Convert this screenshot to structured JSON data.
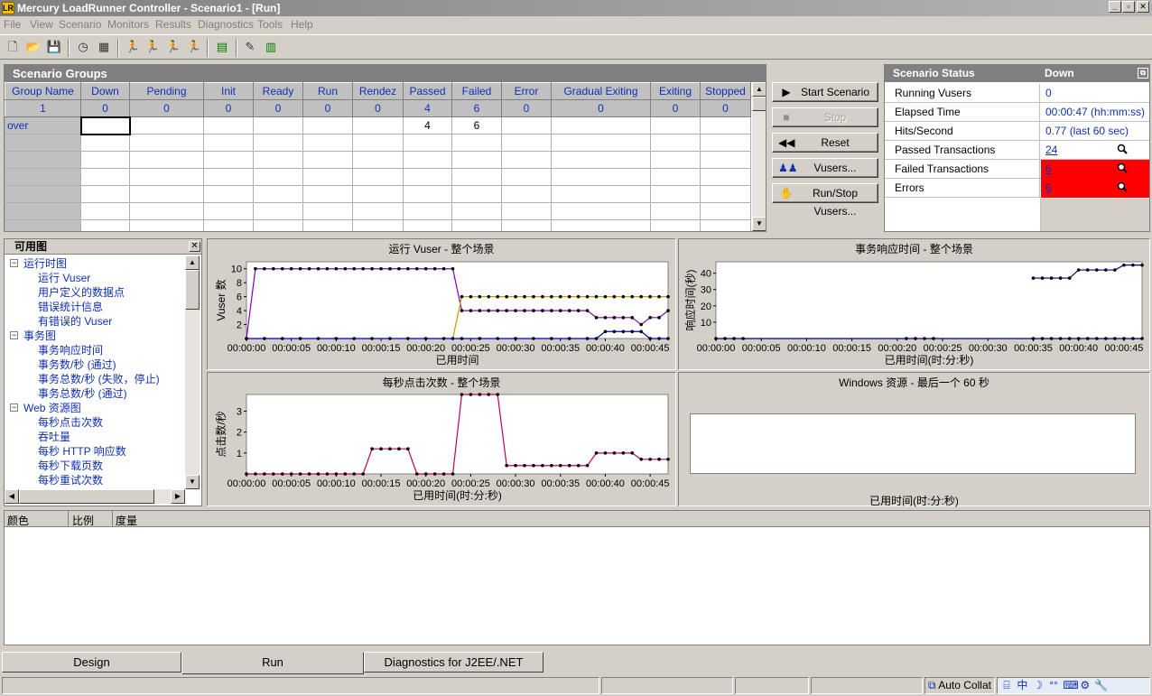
{
  "window": {
    "title": "Mercury LoadRunner Controller - Scenario1 - [Run]",
    "app_icon": "LR"
  },
  "menu": [
    "File",
    "View",
    "Scenario",
    "Monitors",
    "Results",
    "Diagnostics",
    "Tools",
    "Help"
  ],
  "toolbar_icons": [
    "new-icon",
    "open-icon",
    "save-icon",
    "clock-icon",
    "rendezvous-icon",
    "run-vuser-icon",
    "gradual-icon",
    "stop-vuser-icon",
    "reset-vuser-icon",
    "analysis-icon",
    "results-icon",
    "monitor-icon"
  ],
  "groups": {
    "title": "Scenario Groups",
    "columns": [
      "Group Name",
      "Down",
      "Pending",
      "Init",
      "Ready",
      "Run",
      "Rendez",
      "Passed",
      "Failed",
      "Error",
      "Gradual Exiting",
      "Exiting",
      "Stopped"
    ],
    "totals": [
      "1",
      "0",
      "0",
      "0",
      "0",
      "0",
      "0",
      "4",
      "6",
      "0",
      "0",
      "0",
      "0"
    ],
    "rows": [
      [
        "over",
        "",
        "",
        "",
        "",
        "",
        "",
        "4",
        "6",
        "",
        "",
        "",
        ""
      ]
    ]
  },
  "actions": {
    "start": "Start Scenario",
    "stop": "Stop",
    "reset": "Reset",
    "vusers": "Vusers...",
    "runstop": "Run/Stop Vusers..."
  },
  "status": {
    "title": "Scenario Status",
    "state": "Down",
    "rows": [
      {
        "key": "Running Vusers",
        "value": "0"
      },
      {
        "key": "Elapsed Time",
        "value": "00:00:47 (hh:mm:ss)"
      },
      {
        "key": "Hits/Second",
        "value": "0.77 (last 60 sec)"
      },
      {
        "key": "Passed Transactions",
        "value": "24"
      },
      {
        "key": "Failed Transactions",
        "value": "6"
      },
      {
        "key": "Errors",
        "value": "6"
      }
    ],
    "error_color": "#ff0000"
  },
  "tree": {
    "title": "可用图",
    "items": [
      {
        "label": "运行时图",
        "level": 0,
        "box": "−"
      },
      {
        "label": "运行 Vuser",
        "level": 1
      },
      {
        "label": "用户定义的数据点",
        "level": 1
      },
      {
        "label": "错误统计信息",
        "level": 1
      },
      {
        "label": "有错误的 Vuser",
        "level": 1
      },
      {
        "label": "事务图",
        "level": 0,
        "box": "−"
      },
      {
        "label": "事务响应时间",
        "level": 1
      },
      {
        "label": "事务数/秒 (通过)",
        "level": 1
      },
      {
        "label": "事务总数/秒 (失败，停止)",
        "level": 1
      },
      {
        "label": "事务总数/秒 (通过)",
        "level": 1
      },
      {
        "label": "Web 资源图",
        "level": 0,
        "box": "−"
      },
      {
        "label": "每秒点击次数",
        "level": 1
      },
      {
        "label": "吞吐量",
        "level": 1
      },
      {
        "label": "每秒 HTTP 响应数",
        "level": 1
      },
      {
        "label": "每秒下载页数",
        "level": 1
      },
      {
        "label": "每秒重试次数",
        "level": 1
      }
    ]
  },
  "graphs": {
    "vuser": {
      "title": "运行 Vuser - 整个场景",
      "ylabel": "Vuser 数",
      "xlabel": "已用时间"
    },
    "trt": {
      "title": "事务响应时间 - 整个场景",
      "ylabel": "响应时间(秒)",
      "xlabel": "已用时间(时:分:秒)"
    },
    "hits": {
      "title": "每秒点击次数 - 整个场景",
      "ylabel": "点击数/秒",
      "xlabel": "已用时间(时:分:秒)"
    },
    "win": {
      "title": "Windows 资源 - 最后一个 60 秒",
      "xlabel": "已用时间(时:分:秒)"
    }
  },
  "chart_data": [
    {
      "type": "line",
      "title": "运行 Vuser - 整个场景",
      "xlabel": "已用时间",
      "ylabel": "Vuser 数",
      "x_ticks": [
        "00:00:00",
        "00:00:05",
        "00:00:10",
        "00:00:15",
        "00:00:20",
        "00:00:25",
        "00:00:30",
        "00:00:35",
        "00:00:40",
        "00:00:45"
      ],
      "y_ticks": [
        "2",
        "4",
        "6",
        "8",
        "10"
      ],
      "xlim": [
        0,
        47
      ],
      "ylim": [
        0,
        11
      ],
      "series": [
        {
          "color": "#8000c0",
          "x": [
            0,
            1,
            2,
            3,
            4,
            5,
            6,
            7,
            8,
            9,
            10,
            11,
            12,
            13,
            14,
            15,
            16,
            17,
            18,
            19,
            20,
            21,
            22,
            23,
            24,
            25,
            26,
            27,
            28,
            29,
            30,
            31,
            32,
            33,
            34,
            35,
            36,
            37,
            38,
            39,
            40,
            41,
            42,
            43,
            44,
            45,
            46,
            47
          ],
          "y": [
            0,
            10,
            10,
            10,
            10,
            10,
            10,
            10,
            10,
            10,
            10,
            10,
            10,
            10,
            10,
            10,
            10,
            10,
            10,
            10,
            10,
            10,
            10,
            10,
            4,
            4,
            4,
            4,
            4,
            4,
            4,
            4,
            4,
            4,
            4,
            4,
            4,
            4,
            4,
            3,
            3,
            3,
            3,
            3,
            2,
            3,
            3,
            4
          ]
        },
        {
          "color": "#c0a000",
          "x": [
            23,
            24,
            25,
            26,
            27,
            28,
            29,
            30,
            31,
            32,
            33,
            34,
            35,
            36,
            37,
            38,
            39,
            40,
            41,
            42,
            43,
            44,
            45,
            46,
            47
          ],
          "y": [
            0,
            6,
            6,
            6,
            6,
            6,
            6,
            6,
            6,
            6,
            6,
            6,
            6,
            6,
            6,
            6,
            6,
            6,
            6,
            6,
            6,
            6,
            6,
            6,
            6
          ]
        },
        {
          "color": "#0000c0",
          "x": [
            0,
            2,
            4,
            6,
            8,
            10,
            12,
            14,
            16,
            18,
            20,
            22,
            24,
            26,
            28,
            30,
            32,
            34,
            36,
            38,
            39,
            40,
            41,
            42,
            43,
            44,
            45,
            46,
            47
          ],
          "y": [
            0,
            0,
            0,
            0,
            0,
            0,
            0,
            0,
            0,
            0,
            0,
            0,
            0,
            0,
            0,
            0,
            0,
            0,
            0,
            0,
            0,
            1,
            1,
            1,
            1,
            1,
            0,
            0,
            0
          ]
        }
      ]
    },
    {
      "type": "line",
      "title": "事务响应时间 - 整个场景",
      "xlabel": "已用时间(时:分:秒)",
      "ylabel": "响应时间(秒)",
      "x_ticks": [
        "00:00:00",
        "00:00:05",
        "00:00:10",
        "00:00:15",
        "00:00:20",
        "00:00:25",
        "00:00:30",
        "00:00:35",
        "00:00:40",
        "00:00:45"
      ],
      "y_ticks": [
        "10",
        "20",
        "30",
        "40"
      ],
      "xlim": [
        0,
        47
      ],
      "ylim": [
        0,
        47
      ],
      "series": [
        {
          "color": "#000080",
          "x": [
            35,
            36,
            37,
            38,
            39,
            40,
            41,
            42,
            43,
            44,
            45,
            46,
            47
          ],
          "y": [
            37,
            37,
            37,
            37,
            37,
            42,
            42,
            42,
            42,
            42,
            45,
            45,
            45
          ]
        },
        {
          "color": "#000080",
          "x": [
            0,
            1,
            2,
            3,
            21,
            22,
            23,
            24,
            35,
            36,
            37,
            38,
            39,
            40,
            41,
            42,
            43,
            44,
            45,
            46,
            47
          ],
          "y": [
            0,
            0,
            0,
            0,
            0,
            0,
            0,
            0,
            0,
            0,
            0,
            0,
            0,
            0,
            0,
            0,
            0,
            0,
            0,
            0,
            0
          ]
        }
      ]
    },
    {
      "type": "line",
      "title": "每秒点击次数 - 整个场景",
      "xlabel": "已用时间(时:分:秒)",
      "ylabel": "点击数/秒",
      "x_ticks": [
        "00:00:00",
        "00:00:05",
        "00:00:10",
        "00:00:15",
        "00:00:20",
        "00:00:25",
        "00:00:30",
        "00:00:35",
        "00:00:40",
        "00:00:45"
      ],
      "y_ticks": [
        "1",
        "2",
        "3"
      ],
      "xlim": [
        0,
        47
      ],
      "ylim": [
        0,
        3.8
      ],
      "series": [
        {
          "color": "#c00060",
          "x": [
            0,
            1,
            2,
            3,
            4,
            5,
            6,
            7,
            8,
            9,
            10,
            11,
            12,
            13,
            14,
            15,
            16,
            17,
            18,
            19,
            20,
            21,
            22,
            23,
            24,
            25,
            26,
            27,
            28,
            29,
            30,
            31,
            32,
            33,
            34,
            35,
            36,
            37,
            38,
            39,
            40,
            41,
            42,
            43,
            44,
            45,
            46,
            47
          ],
          "y": [
            0,
            0,
            0,
            0,
            0,
            0,
            0,
            0,
            0,
            0,
            0,
            0,
            0,
            0,
            1.2,
            1.2,
            1.2,
            1.2,
            1.2,
            0,
            0,
            0,
            0,
            0,
            3.8,
            3.8,
            3.8,
            3.8,
            3.8,
            0.4,
            0.4,
            0.4,
            0.4,
            0.4,
            0.4,
            0.4,
            0.4,
            0.4,
            0.4,
            1,
            1,
            1,
            1,
            1,
            0.7,
            0.7,
            0.7,
            0.7
          ]
        }
      ]
    }
  ],
  "legend": {
    "col_color": "颜色",
    "col_scale": "比例",
    "col_measure": "度量"
  },
  "tabs": [
    "Design",
    "Run",
    "Diagnostics for J2EE/.NET"
  ],
  "statusbar": {
    "auto": "Auto Collat",
    "tray": [
      "中",
      "☽",
      "°°",
      "⌨",
      "⚙",
      "🔧"
    ]
  }
}
